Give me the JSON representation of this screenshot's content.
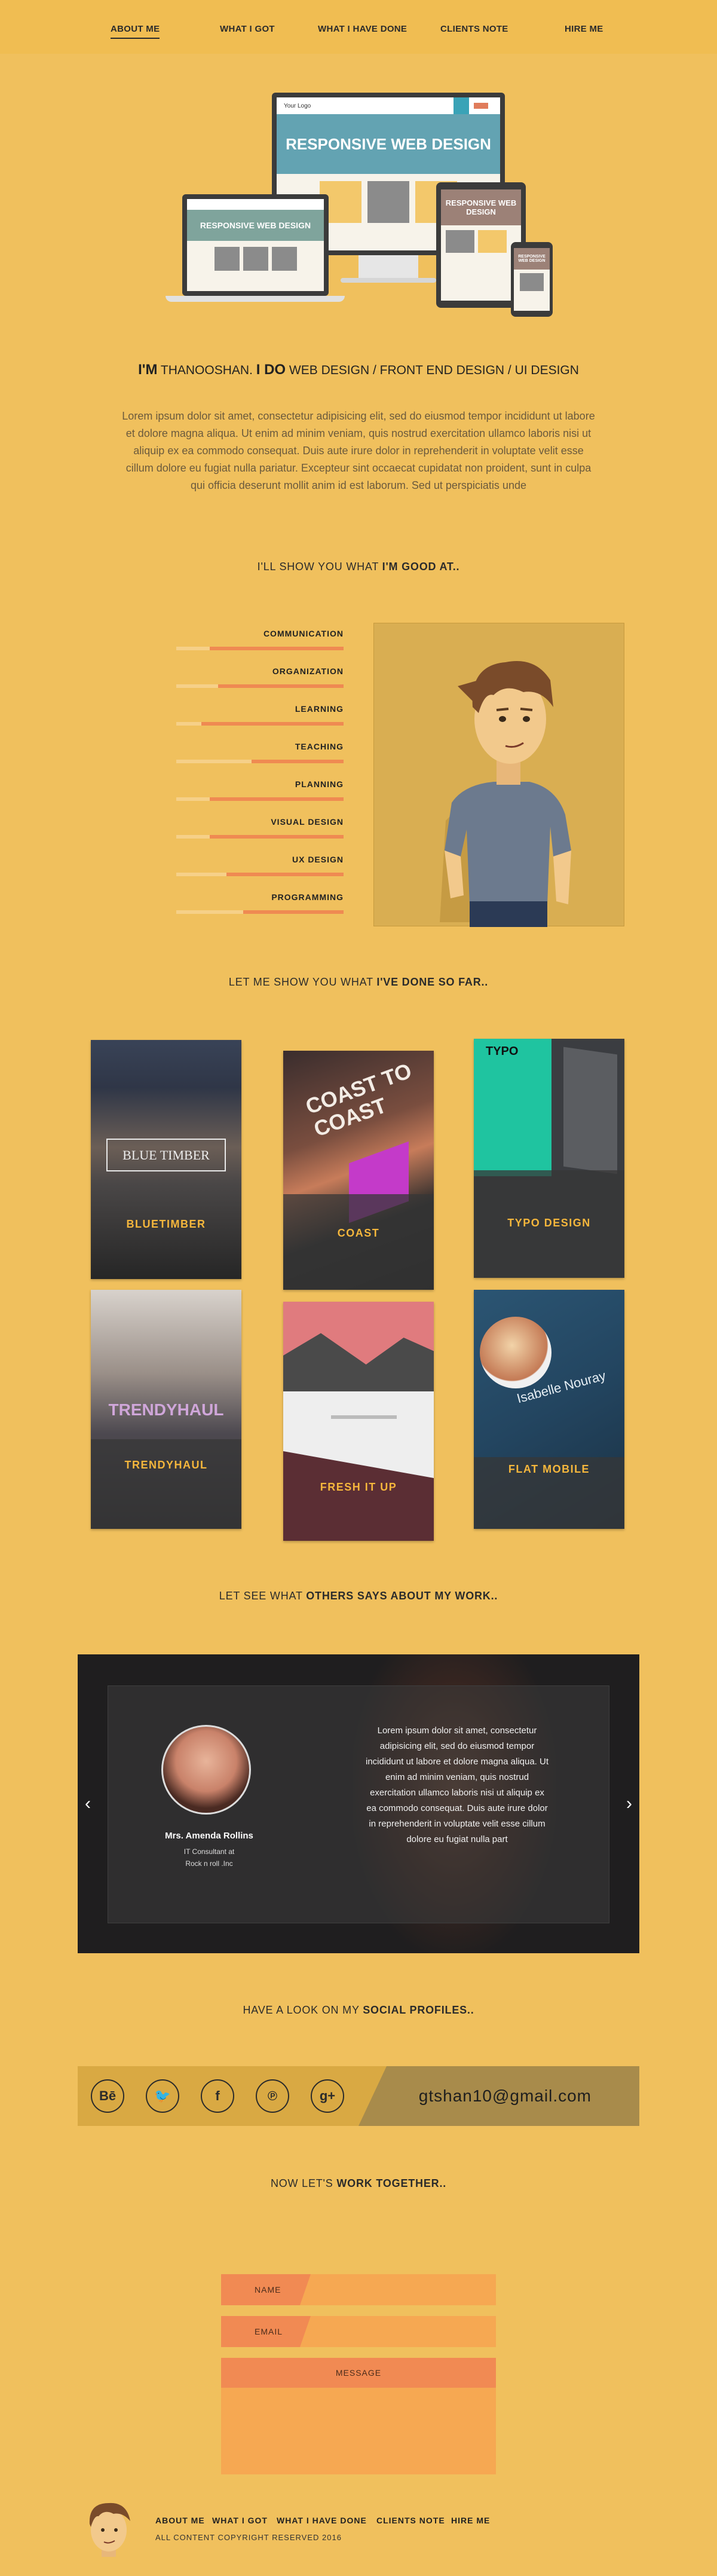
{
  "nav": {
    "items": [
      {
        "label": "ABOUT ME",
        "active": true
      },
      {
        "label": "WHAT I GOT",
        "active": false
      },
      {
        "label": "WHAT I HAVE DONE",
        "active": false
      },
      {
        "label": "CLIENTS NOTE",
        "active": false
      },
      {
        "label": "HIRE ME",
        "active": false
      }
    ]
  },
  "hero": {
    "devices": {
      "desktop_heading": "RESPONSIVE WEB DESIGN",
      "laptop_heading": "RESPONSIVE WEB DESIGN",
      "tablet_heading": "RESPONSIVE WEB DESIGN",
      "phone_heading": "RESPONSIVE WEB DESIGN",
      "logo": "Your Logo"
    },
    "intro_im": "I'M",
    "intro_name": " THANOOSHAN. ",
    "intro_ido": "I DO",
    "intro_rest": " WEB DESIGN / FRONT END DESIGN / UI DESIGN",
    "lorem": "Lorem ipsum dolor sit amet, consectetur adipisicing elit, sed do eiusmod tempor incididunt ut labore et dolore magna aliqua. Ut enim ad minim veniam, quis nostrud exercitation ullamco laboris nisi ut aliquip ex ea commodo consequat. Duis aute irure dolor in reprehenderit in voluptate velit esse cillum dolore eu fugiat nulla pariatur. Excepteur sint occaecat cupidatat non proident, sunt in culpa qui officia deserunt mollit anim id est laborum. Sed ut perspiciatis unde"
  },
  "skills": {
    "heading_pre": "I'LL SHOW YOU WHAT ",
    "heading_bold": "I'M GOOD AT..",
    "items": [
      {
        "label": "COMMUNICATION",
        "level": 0.8
      },
      {
        "label": "ORGANIZATION",
        "level": 0.75
      },
      {
        "label": "LEARNING",
        "level": 0.85
      },
      {
        "label": "TEACHING",
        "level": 0.55
      },
      {
        "label": "PLANNING",
        "level": 0.8
      },
      {
        "label": "VISUAL DESIGN",
        "level": 0.8
      },
      {
        "label": "UX DESIGN",
        "level": 0.7
      },
      {
        "label": "PROGRAMMING",
        "level": 0.6
      }
    ]
  },
  "portfolio": {
    "heading_pre": "LET ME SHOW YOU WHAT ",
    "heading_bold": "I'VE DONE SO FAR..",
    "items": [
      {
        "title": "BLUETIMBER",
        "art_text": "BLUE TIMBER"
      },
      {
        "title": "COAST",
        "art_text": "COAST TO COAST"
      },
      {
        "title": "TYPO DESIGN",
        "art_text": "TYPO"
      },
      {
        "title": "TRENDYHAUL",
        "art_text": "TRENDYHAUL"
      },
      {
        "title": "FRESH IT UP",
        "art_text": ""
      },
      {
        "title": "FLAT MOBILE",
        "art_text": "Isabelle Nouray"
      }
    ]
  },
  "testimonial": {
    "heading_pre": "LET SEE WHAT ",
    "heading_bold": "OTHERS SAYS ABOUT MY WORK..",
    "quote": "Lorem ipsum dolor sit amet, consectetur adipisicing elit, sed do eiusmod tempor incididunt ut labore et dolore magna aliqua. Ut enim ad minim veniam, quis nostrud exercitation ullamco laboris nisi ut aliquip ex ea commodo consequat. Duis aute irure dolor in reprehenderit in voluptate velit esse cillum dolore eu fugiat nulla part",
    "name": "Mrs. Amenda Rollins",
    "role1": "IT Consultant at",
    "role2": "Rock n roll .Inc",
    "prev": "‹",
    "next": "›"
  },
  "social": {
    "heading_pre": "HAVE A LOOK ON MY ",
    "heading_bold": "SOCIAL PROFILES..",
    "icons": [
      {
        "name": "behance-icon",
        "glyph": "Bē"
      },
      {
        "name": "twitter-icon",
        "glyph": "🐦"
      },
      {
        "name": "facebook-icon",
        "glyph": "f"
      },
      {
        "name": "pinterest-icon",
        "glyph": "℗"
      },
      {
        "name": "google-plus-icon",
        "glyph": "g+"
      }
    ],
    "email": "gtshan10@gmail.com"
  },
  "contact": {
    "heading_pre": "NOW LET'S ",
    "heading_bold": "WORK TOGETHER..",
    "name_label": "NAME",
    "email_label": "EMAIL",
    "message_label": "MESSAGE"
  },
  "footer": {
    "links": [
      "ABOUT ME",
      "WHAT I GOT",
      "WHAT I HAVE DONE",
      "CLIENTS NOTE",
      "HIRE ME"
    ],
    "copyright": "ALL CONTENT COPYRIGHT RESERVED 2016"
  },
  "colors": {
    "background": "#f0c05d",
    "accent": "#ef8a52",
    "card_title": "#f6b73c"
  }
}
